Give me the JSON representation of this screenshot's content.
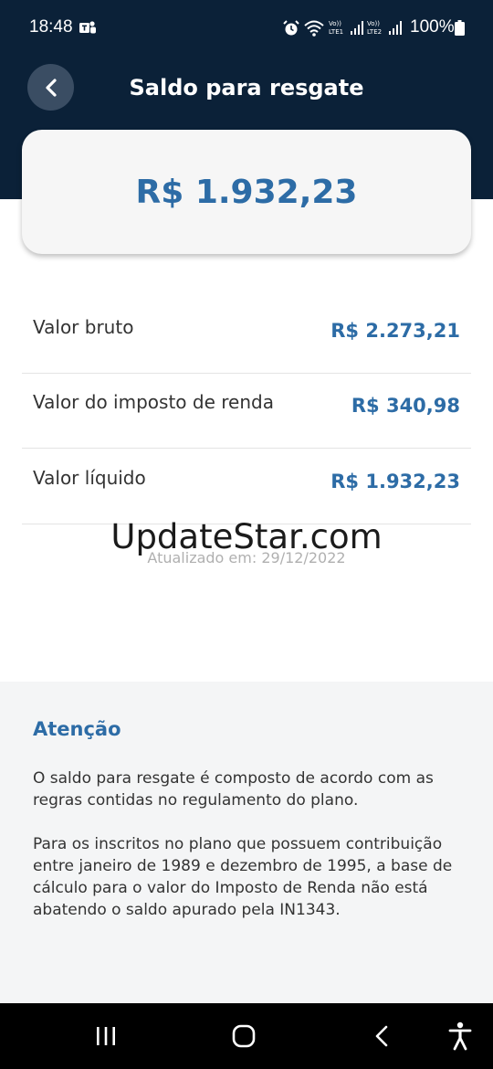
{
  "status_bar": {
    "time": "18:48",
    "battery": "100%",
    "icons": [
      "teams-icon",
      "alarm-icon",
      "wifi-icon",
      "lte1-signal-icon",
      "lte2-signal-icon",
      "battery-icon"
    ]
  },
  "header": {
    "title": "Saldo para resgate",
    "back_icon": "chevron-left-icon"
  },
  "balance": {
    "value": "R$ 1.932,23"
  },
  "rows": [
    {
      "label": "Valor bruto",
      "value": "R$ 2.273,21"
    },
    {
      "label": "Valor do imposto de renda",
      "value": "R$ 340,98"
    },
    {
      "label": "Valor líquido",
      "value": "R$ 1.932,23"
    }
  ],
  "watermark": "UpdateStar.com",
  "updated": "Atualizado em: 29/12/2022",
  "attention": {
    "title": "Atenção",
    "paragraph1": "O saldo para resgate é composto de acordo com as regras contidas no regulamento do plano.",
    "paragraph2": "Para os inscritos no plano que possuem contribuição entre janeiro de 1989 e dezembro de 1995, a base de cálculo para o valor do Imposto de Renda não está abatendo o saldo apurado pela IN1343."
  },
  "colors": {
    "header_bg": "#0b2138",
    "accent": "#2d6ca6",
    "attention_bg": "#f4f5f6"
  },
  "navbar": {
    "icons": [
      "recent-apps-icon",
      "home-icon",
      "back-icon",
      "accessibility-icon"
    ]
  }
}
